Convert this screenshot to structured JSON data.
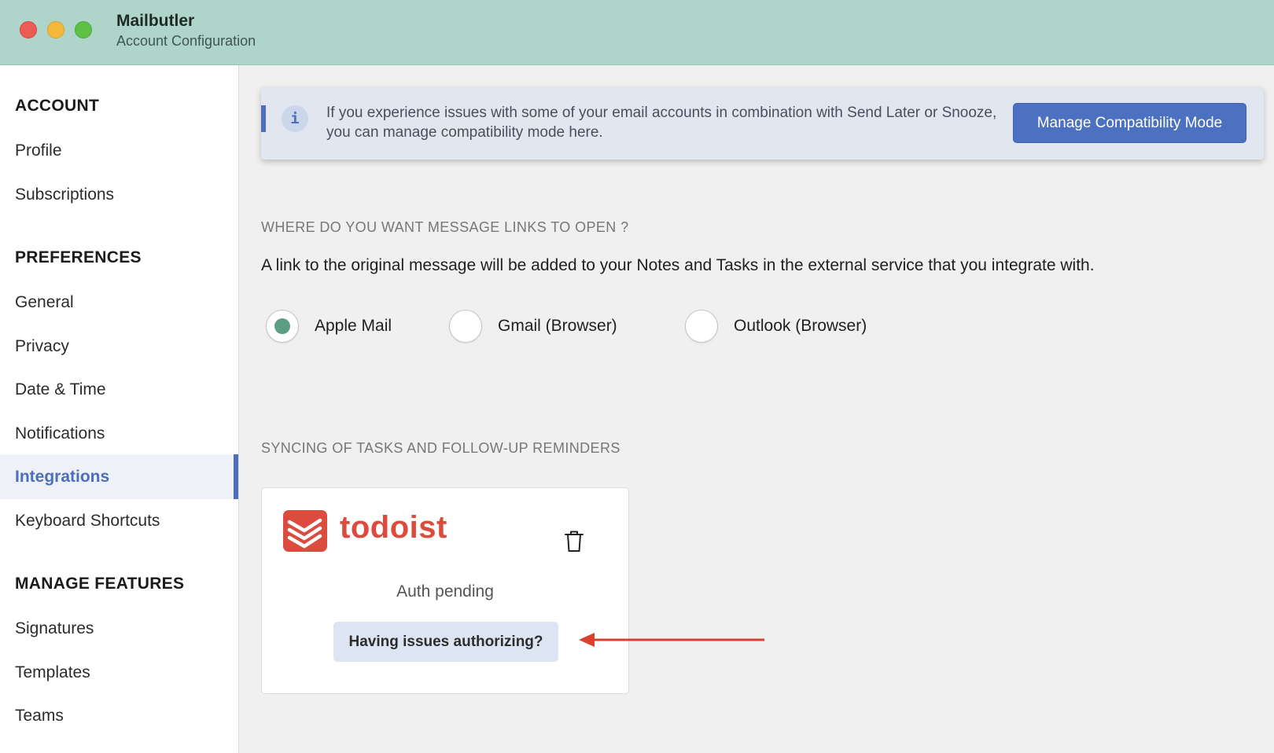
{
  "window": {
    "app_name": "Mailbutler",
    "subtitle": "Account Configuration"
  },
  "sidebar": {
    "sections": [
      {
        "title": "ACCOUNT",
        "items": [
          {
            "label": "Profile"
          },
          {
            "label": "Subscriptions"
          }
        ]
      },
      {
        "title": "PREFERENCES",
        "items": [
          {
            "label": "General"
          },
          {
            "label": "Privacy"
          },
          {
            "label": "Date & Time"
          },
          {
            "label": "Notifications"
          },
          {
            "label": "Integrations",
            "active": true
          },
          {
            "label": "Keyboard Shortcuts"
          }
        ]
      },
      {
        "title": "MANAGE FEATURES",
        "items": [
          {
            "label": "Signatures"
          },
          {
            "label": "Templates"
          },
          {
            "label": "Teams"
          }
        ]
      }
    ]
  },
  "banner": {
    "text": "If you experience issues with some of your email accounts in combination with Send Later or Snooze, you can manage compatibility mode here.",
    "button_label": "Manage Compatibility Mode"
  },
  "message_links": {
    "heading": "WHERE DO YOU WANT MESSAGE LINKS TO OPEN ?",
    "description": "A link to the original message will be added to your Notes and Tasks in the external service that you integrate with.",
    "options": [
      {
        "label": "Apple Mail",
        "selected": true
      },
      {
        "label": "Gmail (Browser)",
        "selected": false
      },
      {
        "label": "Outlook (Browser)",
        "selected": false
      }
    ]
  },
  "syncing": {
    "heading": "SYNCING OF TASKS AND FOLLOW-UP REMINDERS",
    "card": {
      "service_name": "todoist",
      "logo_icon": "todoist-logo-icon",
      "delete_icon": "trash-icon",
      "status": "Auth pending",
      "help_button_label": "Having issues authorizing?"
    }
  },
  "colors": {
    "titlebar": "#afd4c9",
    "accent": "#4b6fba",
    "todoist_red": "#db4c3f",
    "radio_selected": "#5c9e84",
    "annotation_arrow": "#d9412e"
  }
}
